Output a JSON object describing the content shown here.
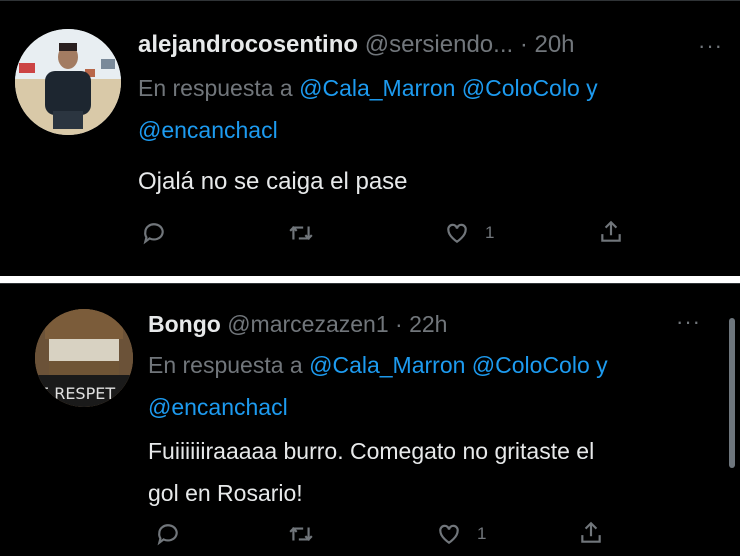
{
  "tweets": [
    {
      "username": "alejandrocosentino",
      "handle": "@sersiendo...",
      "time": "· 20h",
      "reply_prefix": "En respuesta a",
      "mentions": [
        "@Cala_Marron",
        "@ColoColo"
      ],
      "conjunction": "y",
      "mention_last": "@encanchacl",
      "text": "Ojalá no se caiga el pase",
      "likes": "1",
      "more": "···"
    },
    {
      "username": "Bongo",
      "handle": "@marcezazen1",
      "time": "· 22h",
      "reply_prefix": "En respuesta a",
      "mentions": [
        "@Cala_Marron",
        "@ColoColo"
      ],
      "conjunction": "y",
      "mention_last": "@encanchacl",
      "text_line1": "Fuiiiiiiraaaaa burro. Comegato no gritaste el",
      "text_line2": "gol en Rosario!",
      "likes": "1",
      "avatar_text": "E RESPET",
      "more": "···"
    }
  ],
  "colors": {
    "background": "#000000",
    "text": "#e7e9ea",
    "secondary": "#71767b",
    "link": "#1d9bf0"
  }
}
